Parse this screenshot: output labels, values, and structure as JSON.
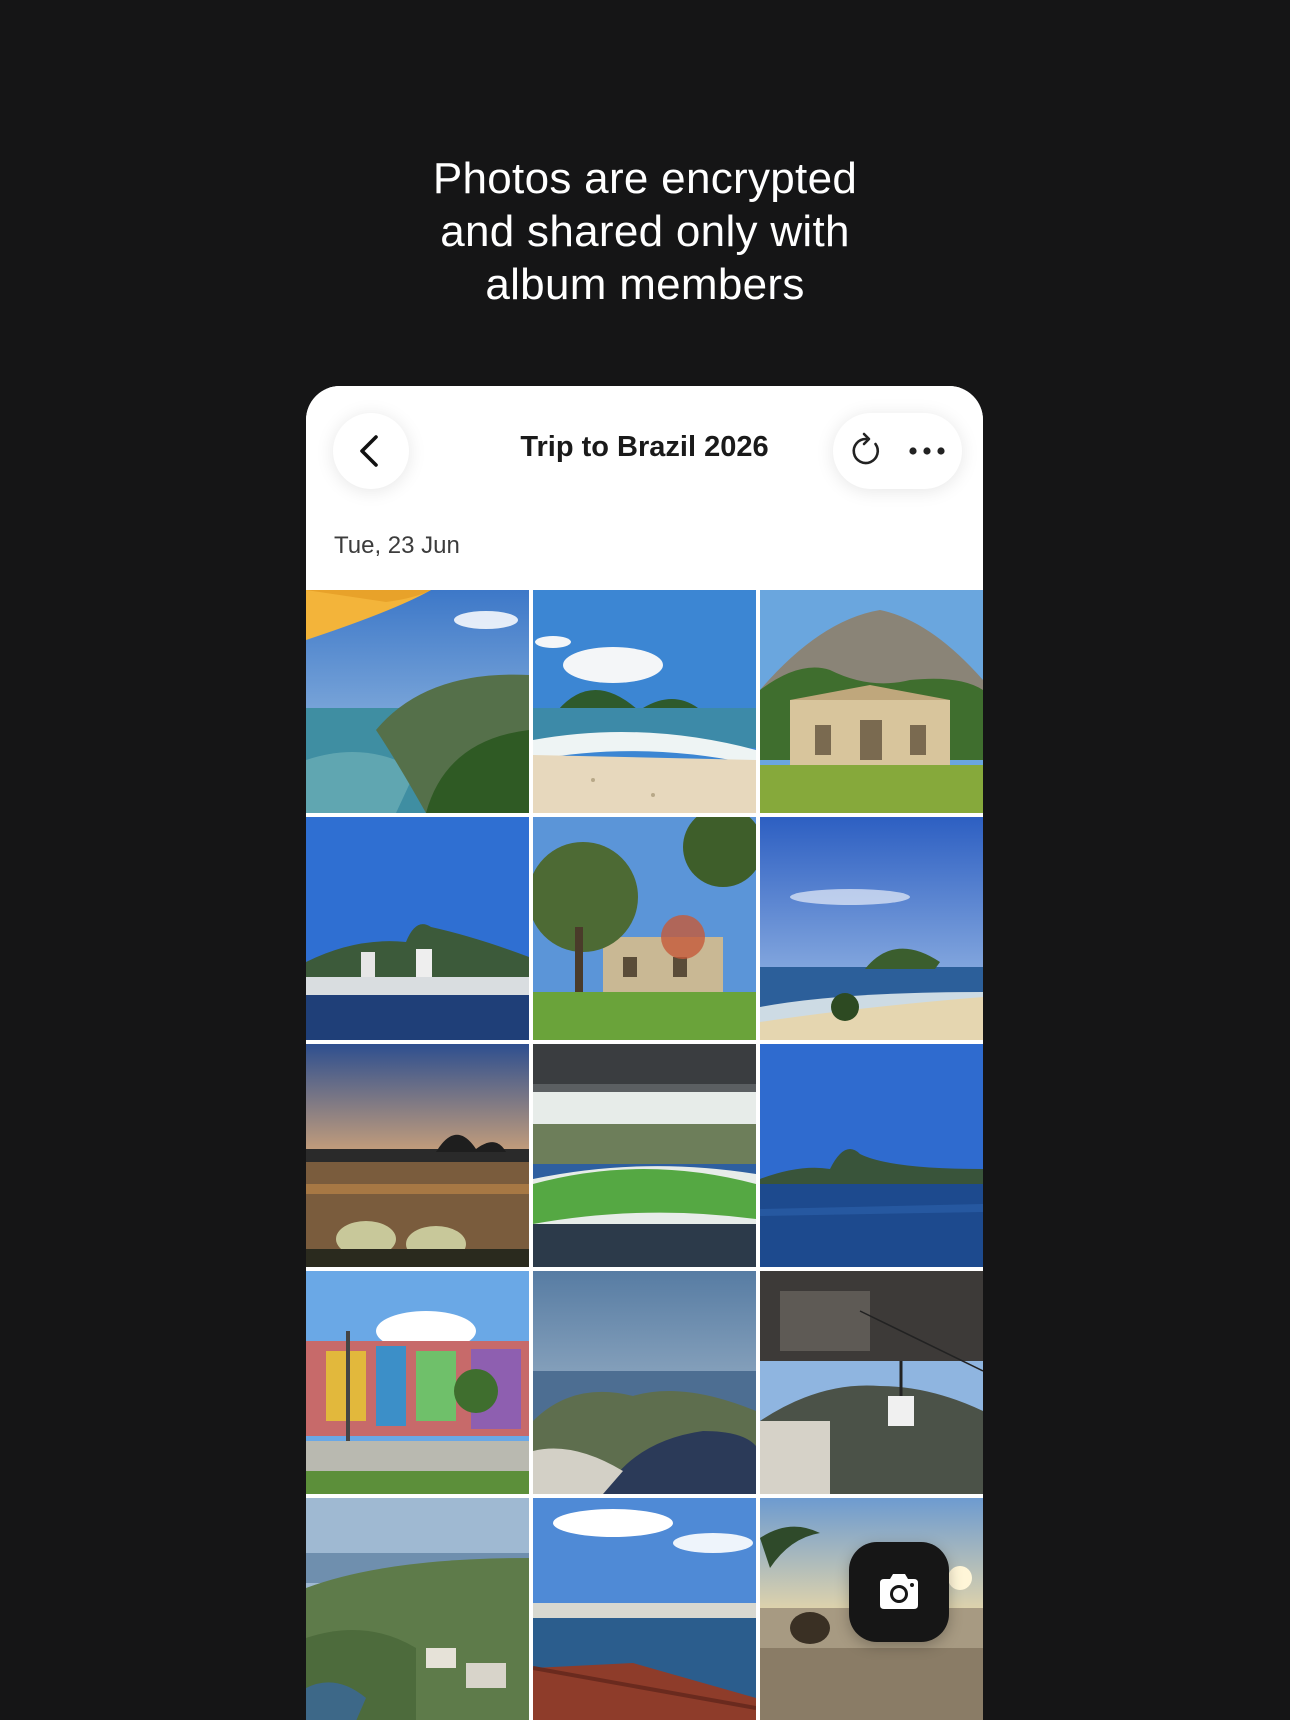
{
  "headline": {
    "line1": "Photos are encrypted",
    "line2": "and shared only with",
    "line3": "album members"
  },
  "album": {
    "title": "Trip to Brazil 2026",
    "date_label": "Tue, 23 Jun"
  },
  "icons": {
    "back": "chevron-left-icon",
    "sync": "refresh-icon",
    "more": "more-horizontal-icon",
    "camera": "camera-icon"
  },
  "colors": {
    "background": "#151516",
    "card": "#ffffff",
    "fab": "#161616"
  },
  "photos": [
    {
      "id": 1,
      "subject": "coastline with umbrella"
    },
    {
      "id": 2,
      "subject": "sandy beach and islands"
    },
    {
      "id": 3,
      "subject": "mountain and historic palace"
    },
    {
      "id": 4,
      "subject": "city skyline by the sea"
    },
    {
      "id": 5,
      "subject": "tree and old building in park"
    },
    {
      "id": 6,
      "subject": "island off the beach"
    },
    {
      "id": 7,
      "subject": "sunset over lagoon"
    },
    {
      "id": 8,
      "subject": "football stadium"
    },
    {
      "id": 9,
      "subject": "sugarloaf over bay"
    },
    {
      "id": 10,
      "subject": "colorful mural building with palms"
    },
    {
      "id": 11,
      "subject": "aerial view of bay"
    },
    {
      "id": 12,
      "subject": "cable car station"
    },
    {
      "id": 13,
      "subject": "green hills and town"
    },
    {
      "id": 14,
      "subject": "boardwalk overlooking beach"
    },
    {
      "id": 15,
      "subject": "beach at sunset with palm"
    }
  ]
}
